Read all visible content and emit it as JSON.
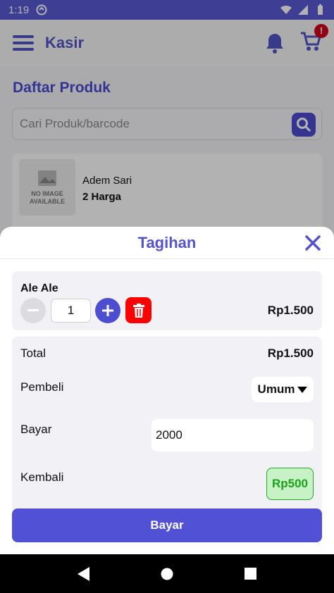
{
  "status_bar": {
    "time": "1:19"
  },
  "app_bar": {
    "title": "Kasir",
    "cart_badge": "!"
  },
  "page": {
    "heading": "Daftar Produk",
    "search_placeholder": "Cari Produk/barcode",
    "product": {
      "name": "Adem Sari",
      "subtitle": "2 Harga",
      "no_image_line1": "NO IMAGE",
      "no_image_line2": "AVAILABLE"
    }
  },
  "sheet": {
    "title": "Tagihan",
    "item": {
      "name": "Ale Ale",
      "qty": "1",
      "price": "Rp1.500"
    },
    "total_label": "Total",
    "total_value": "Rp1.500",
    "buyer_label": "Pembeli",
    "buyer_value": "Umum",
    "pay_label": "Bayar",
    "pay_value": "2000",
    "change_label": "Kembali",
    "change_value": "Rp500",
    "pay_button": "Bayar"
  },
  "colors": {
    "primary": "#5151d6",
    "delete": "#ff0000",
    "change_bg": "#c6f2c6",
    "change_text": "#1aa31a"
  }
}
